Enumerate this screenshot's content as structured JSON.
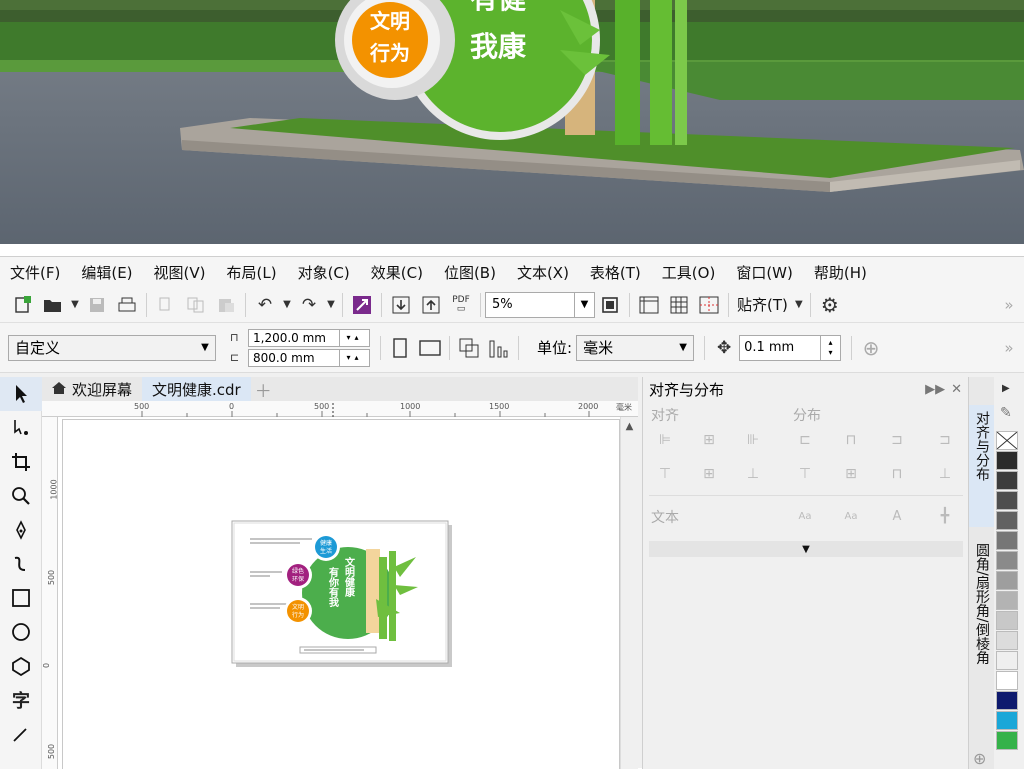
{
  "photo": {
    "sign_circle_text_line1": "文明",
    "sign_circle_text_line2": "行为",
    "sign_panel_text_top": "有健",
    "sign_panel_text_bottom": "我康"
  },
  "menubar": {
    "items": [
      "文件(F)",
      "编辑(E)",
      "视图(V)",
      "布局(L)",
      "对象(C)",
      "效果(C)",
      "位图(B)",
      "文本(X)",
      "表格(T)",
      "工具(O)",
      "窗口(W)",
      "帮助(H)"
    ]
  },
  "toolbar1": {
    "zoom_value": "5%",
    "snap_label": "贴齐(T)",
    "pdf_label": "PDF"
  },
  "toolbar2": {
    "preset_value": "自定义",
    "width_value": "1,200.0 mm",
    "height_value": "800.0 mm",
    "unit_label": "单位:",
    "unit_value": "毫米",
    "nudge_value": "0.1 mm"
  },
  "doc_tabs": {
    "welcome": "欢迎屏幕",
    "document": "文明健康.cdr"
  },
  "rulers": {
    "h_labels": [
      "500",
      "0",
      "500",
      "1000",
      "1500",
      "2000",
      "毫米"
    ],
    "v_labels": [
      "1000",
      "500",
      "0",
      "500"
    ]
  },
  "artwork": {
    "circle1_line1": "健康",
    "circle1_line2": "生活",
    "circle2_line1": "绿色",
    "circle2_line2": "环保",
    "circle3_line1": "文明",
    "circle3_line2": "行为",
    "main_col1": "有你有我",
    "main_col2": "文明健康"
  },
  "panel": {
    "title": "对齐与分布",
    "section_align": "对齐",
    "section_distribute": "分布",
    "section_text": "文本"
  },
  "side_tabs": {
    "tab1": "对齐与分布",
    "tab2": "圆角/扇形角/倒棱角"
  },
  "palette": {
    "colors": [
      "#2b2b2b",
      "#3c3c3c",
      "#4e4e4e",
      "#616161",
      "#767676",
      "#8a8a8a",
      "#9e9e9e",
      "#b3b3b3",
      "#c8c8c8",
      "#dcdcdc",
      "#efefef",
      "#ffffff",
      "#0e1a6e",
      "#1aa7d8",
      "#35b24a"
    ]
  },
  "icons": {
    "theme": "#0078d7",
    "artwork_green": "#4cae4c",
    "artwork_orange": "#f39200",
    "artwork_purple": "#a2207f",
    "artwork_blue": "#1d9ad6"
  }
}
